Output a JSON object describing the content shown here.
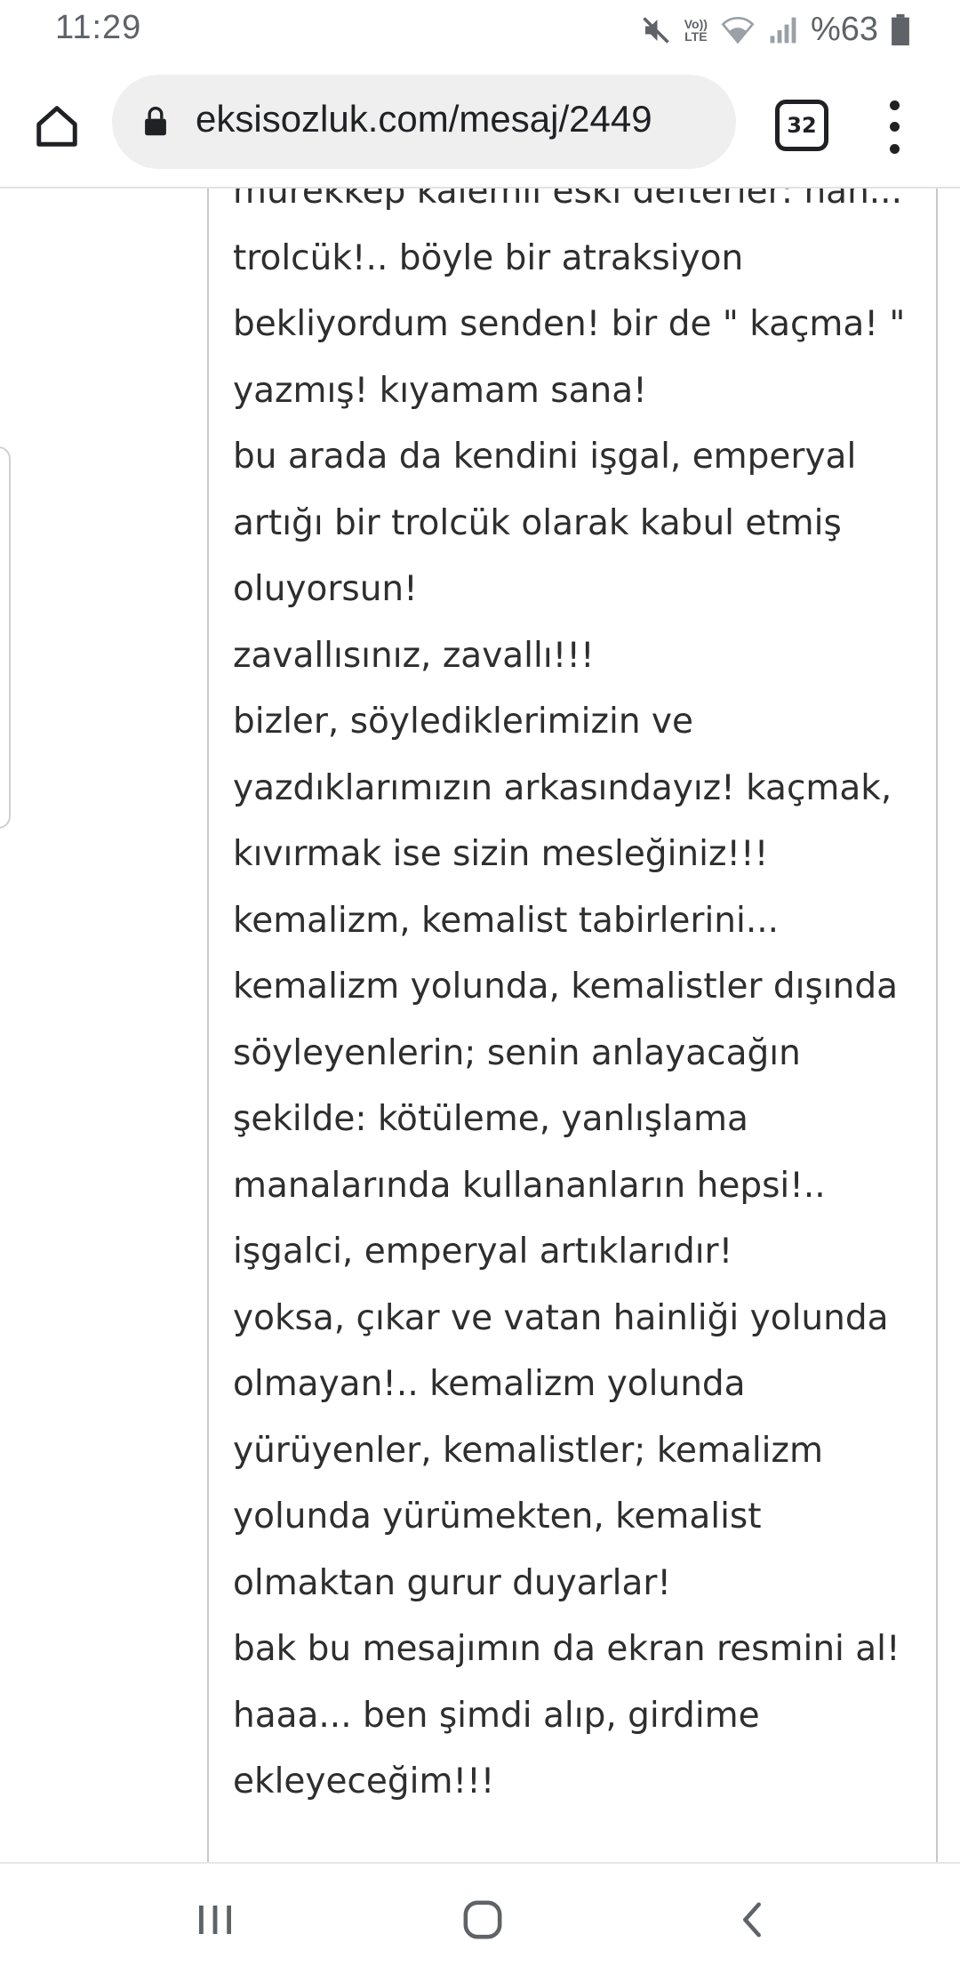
{
  "status_bar": {
    "time": "11:29",
    "volte_label_top": "Vo))",
    "volte_label_bottom": "LTE",
    "battery": "%63",
    "icons": [
      "mute-icon",
      "volte-icon",
      "wifi-icon",
      "signal-icon",
      "battery-icon"
    ]
  },
  "browser": {
    "url": "eksisozluk.com/mesaj/2449",
    "tab_count": "32",
    "icons": [
      "home-icon",
      "lock-icon",
      "tabs-icon",
      "more-menu-icon"
    ]
  },
  "message": {
    "lines": [
      "mürekkep kalemli eski defterler: han...",
      "trolcük!.. böyle bir atraksiyon",
      "bekliyordum senden! bir de \" kaçma! \"",
      "yazmış! kıyamam sana!",
      "bu arada da kendini işgal, emperyal",
      "artığı bir trolcük olarak kabul etmiş",
      "oluyorsun!",
      "zavallısınız, zavallı!!!",
      "bizler, söylediklerimizin ve",
      "yazdıklarımızın arkasındayız! kaçmak,",
      "kıvırmak ise sizin mesleğiniz!!!",
      "kemalizm, kemalist tabirlerini...",
      "kemalizm yolunda, kemalistler dışında",
      "söyleyenlerin; senin anlayacağın",
      "şekilde: kötüleme, yanlışlama",
      "manalarında kullananların hepsi!..",
      "işgalci, emperyal artıklarıdır!",
      "yoksa, çıkar ve vatan hainliği yolunda",
      "olmayan!.. kemalizm yolunda",
      "yürüyenler, kemalistler; kemalizm",
      "yolunda yürümekten, kemalist",
      "olmaktan gurur duyarlar!",
      "bak bu mesajımın da ekran resmini al!",
      "haaa... ben şimdi alıp, girdime",
      "ekleyeceğim!!!"
    ]
  },
  "nav_bar": {
    "icons": [
      "recent-apps-icon",
      "home-nav-icon",
      "back-icon"
    ]
  },
  "colors": {
    "text": "#2e2e2e",
    "status_text": "#5f6368",
    "omnibox_bg": "#efefef",
    "border": "#c8c8c8"
  }
}
